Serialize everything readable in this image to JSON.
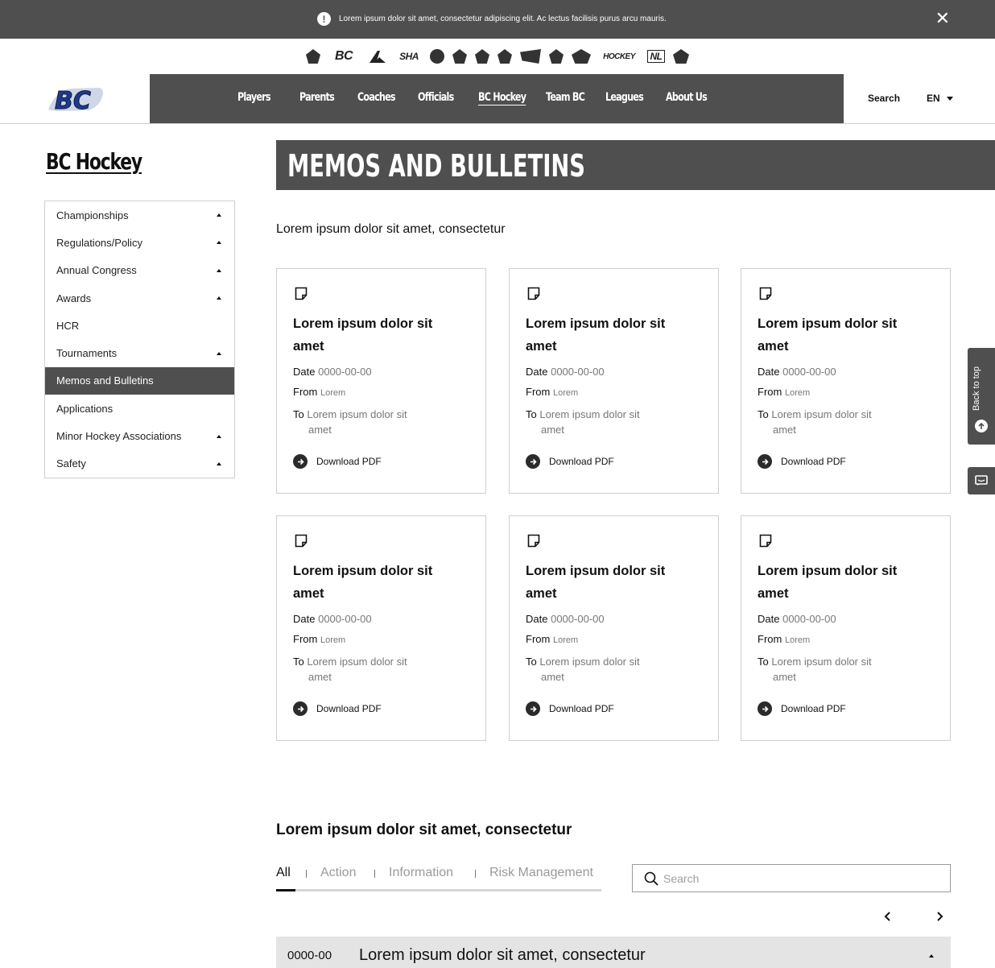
{
  "alert": {
    "message": "Lorem ipsum dolor sit amet, consectetur adipiscing elit. Ac lectus facilisis purus arcu mauris.",
    "icon": "exclamation-icon"
  },
  "partners": [
    "hockey-canada-logo",
    "bc-logo",
    "alberta-logo",
    "saskatchewan-logo",
    "manitoba-logo",
    "ohf-logo",
    "hockey-quebec-logo",
    "hockey-nb-logo",
    "hockey-ns-logo",
    "hockey-pei-logo",
    "hockey-north-logo",
    "hockey-nunavut-logo",
    "hockey-nl-logo",
    "hockey-yukon-logo",
    "hockey-nwt-logo"
  ],
  "partner_labels": {
    "bc": "BC",
    "sha": "SHA",
    "hockey": "HOCKEY",
    "nl": "NL"
  },
  "header": {
    "logo_text": "BC",
    "nav": [
      "Players",
      "Parents",
      "Coaches",
      "Officials",
      "BC Hockey",
      "Team BC",
      "Leagues",
      "About Us"
    ],
    "active_nav": "BC Hockey",
    "search_label": "Search",
    "language": "EN"
  },
  "sidebar": {
    "title": "BC Hockey",
    "items": [
      {
        "label": "Championships",
        "expandable": true
      },
      {
        "label": "Regulations/Policy",
        "expandable": true
      },
      {
        "label": "Annual Congress",
        "expandable": true
      },
      {
        "label": "Awards",
        "expandable": true
      },
      {
        "label": "HCR",
        "expandable": false
      },
      {
        "label": "Tournaments",
        "expandable": true
      },
      {
        "label": "Memos and Bulletins",
        "expandable": false,
        "active": true
      },
      {
        "label": "Applications",
        "expandable": false
      },
      {
        "label": "Minor Hockey Associations",
        "expandable": true
      },
      {
        "label": "Safety",
        "expandable": true
      }
    ]
  },
  "page": {
    "title": "MEMOS AND BULLETINS",
    "intro": "Lorem ipsum dolor sit amet, consectetur"
  },
  "card_labels": {
    "date": "Date",
    "from": "From",
    "to": "To",
    "download": "Download PDF"
  },
  "cards": [
    {
      "title": "Lorem ipsum dolor sit amet",
      "date": "0000-00-00",
      "from": "Lorem",
      "to_1": "Lorem ipsum dolor sit",
      "to_2": "amet"
    },
    {
      "title": "Lorem ipsum dolor sit amet",
      "date": "0000-00-00",
      "from": "Lorem",
      "to_1": "Lorem ipsum dolor sit",
      "to_2": "amet"
    },
    {
      "title": "Lorem ipsum dolor sit amet",
      "date": "0000-00-00",
      "from": "Lorem",
      "to_1": "Lorem ipsum dolor sit",
      "to_2": "amet"
    },
    {
      "title": "Lorem ipsum dolor sit amet",
      "date": "0000-00-00",
      "from": "Lorem",
      "to_1": "Lorem ipsum dolor sit",
      "to_2": "amet"
    },
    {
      "title": "Lorem ipsum dolor sit amet",
      "date": "0000-00-00",
      "from": "Lorem",
      "to_1": "Lorem ipsum dolor sit",
      "to_2": "amet"
    },
    {
      "title": "Lorem ipsum dolor sit amet",
      "date": "0000-00-00",
      "from": "Lorem",
      "to_1": "Lorem ipsum dolor sit",
      "to_2": "amet"
    }
  ],
  "widgets": {
    "back_to_top": "Back to top"
  },
  "list_section": {
    "title": "Lorem ipsum dolor sit amet, consectetur",
    "tabs": [
      "All",
      "Action",
      "Information",
      "Risk Management"
    ],
    "active_tab": "All",
    "search_placeholder": "Search",
    "rows": [
      {
        "date": "0000-00",
        "title": "Lorem ipsum dolor sit amet, consectetur"
      }
    ]
  },
  "colors": {
    "dark_gray": "#4f4f4f",
    "light_gray": "#e4e4e4",
    "brand_blue": "#1f3a8a"
  }
}
